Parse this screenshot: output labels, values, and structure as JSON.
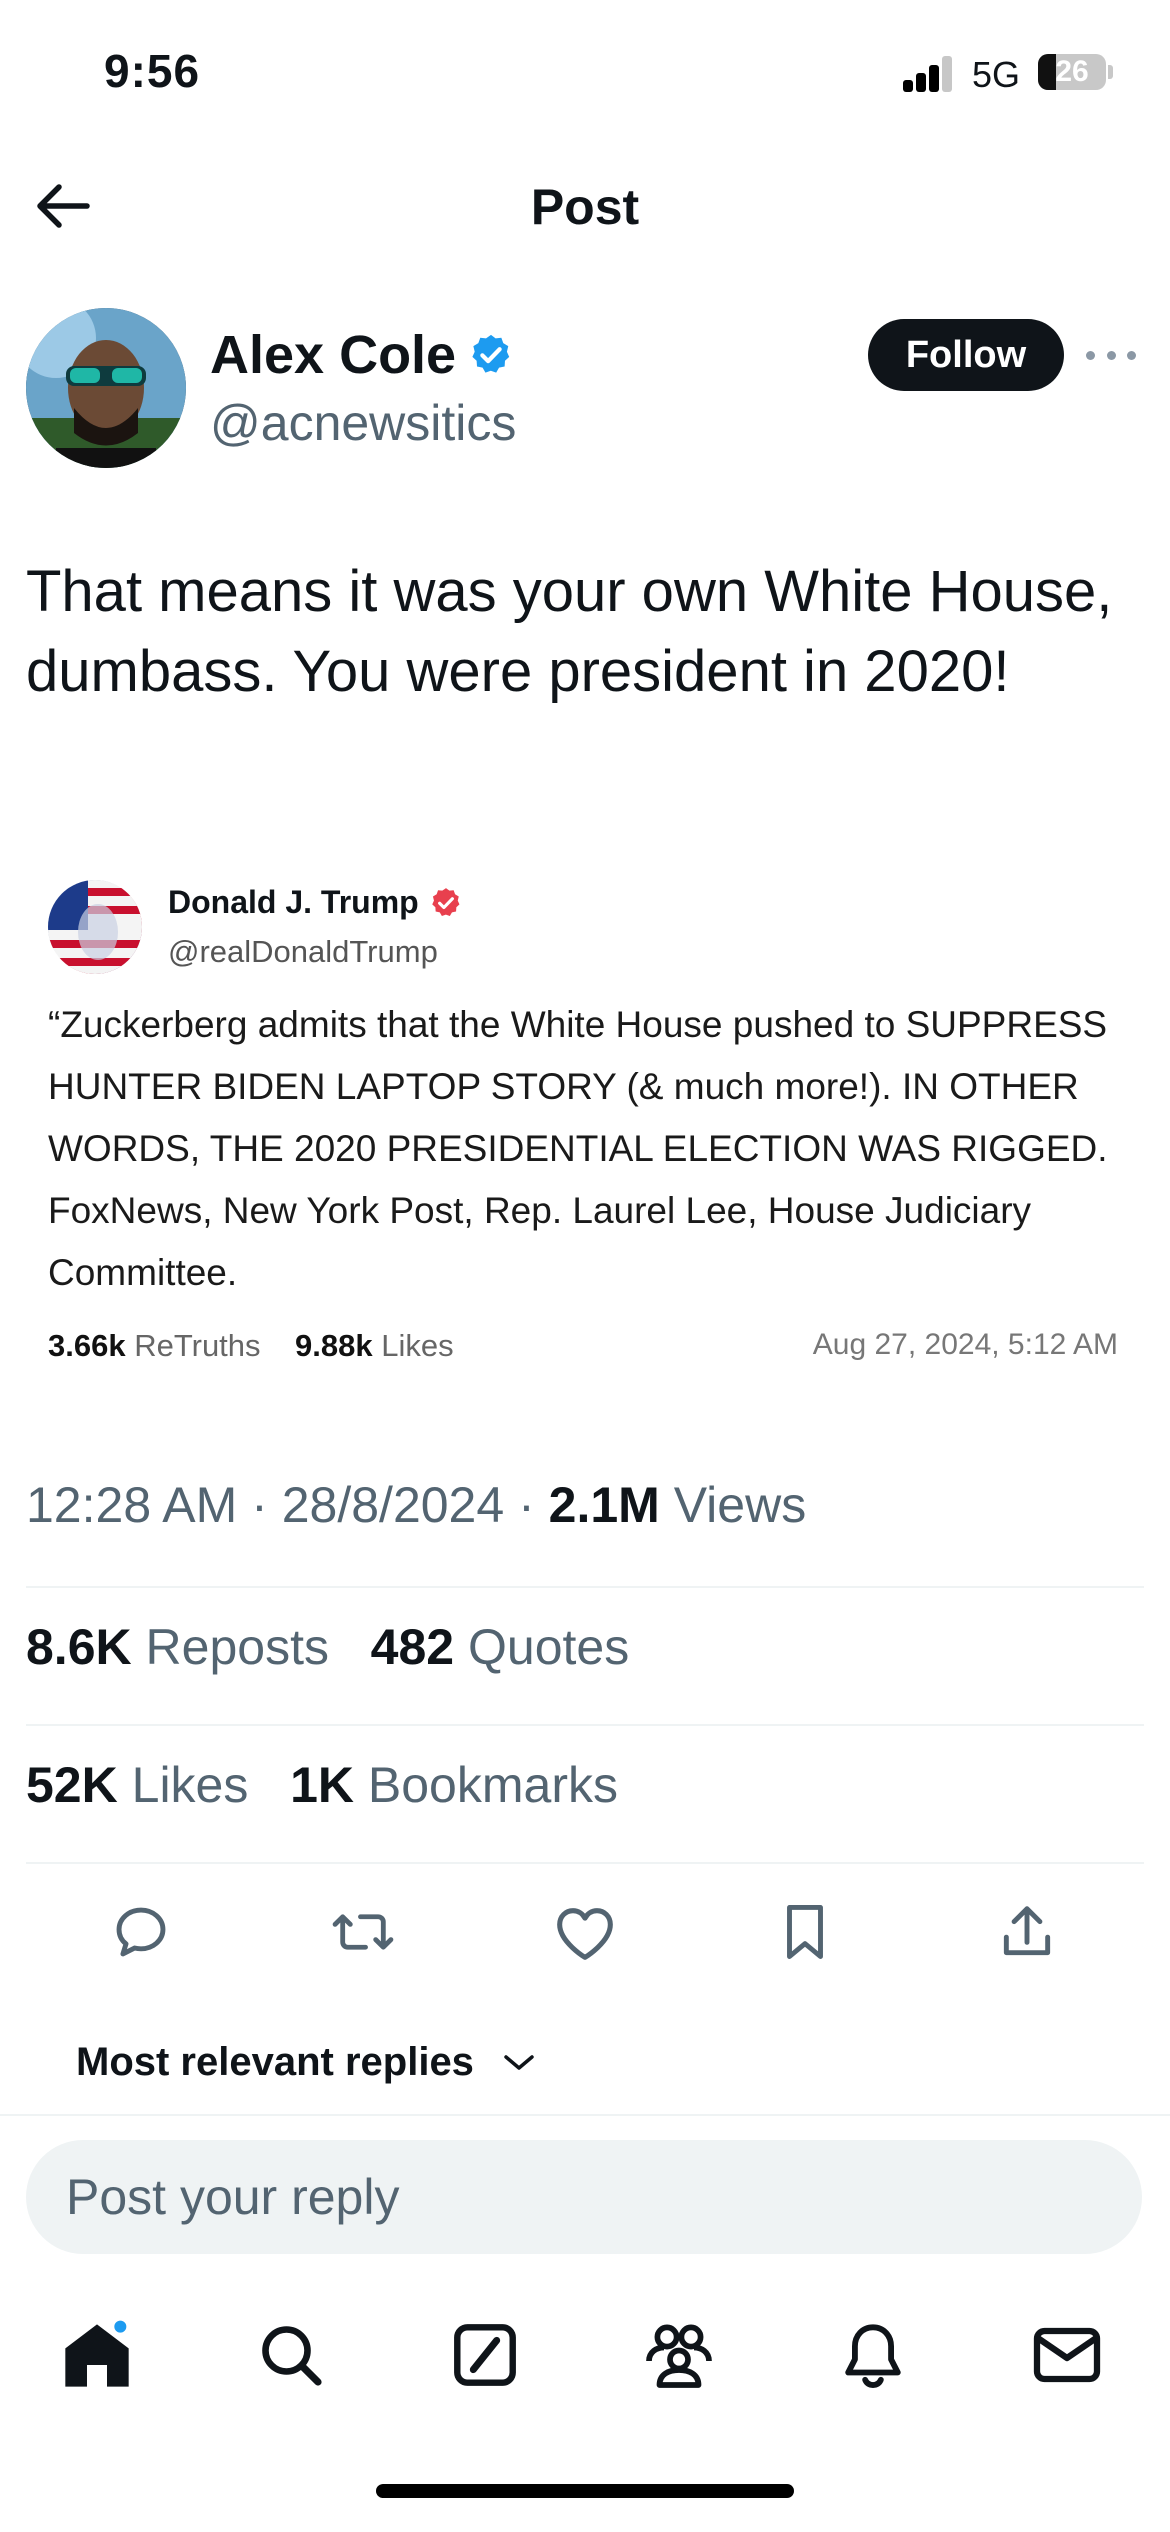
{
  "status": {
    "time": "9:56",
    "network": "5G",
    "battery": "26"
  },
  "header": {
    "title": "Post"
  },
  "author": {
    "name": "Alex Cole",
    "handle": "@acnewsitics",
    "follow_label": "Follow"
  },
  "tweet": {
    "text": "That means it was your own White House, dumbass. You were president in 2020!"
  },
  "quoted": {
    "name": "Donald J. Trump",
    "handle": "@realDonaldTrump",
    "text": "“Zuckerberg admits that the White House pushed to SUPPRESS HUNTER BIDEN LAPTOP STORY (& much more!). IN OTHER WORDS, THE 2020 PRESIDENTIAL ELECTION WAS RIGGED. FoxNews, New York Post, Rep. Laurel Lee, House Judiciary Committee.",
    "retruths_count": "3.66k",
    "retruths_label": "ReTruths",
    "likes_count": "9.88k",
    "likes_label": "Likes",
    "date": "Aug 27, 2024, 5:12 AM"
  },
  "meta": {
    "time": "12:28 AM",
    "date": "28/8/2024",
    "views_count": "2.1M",
    "views_label": "Views"
  },
  "stats": {
    "reposts_count": "8.6K",
    "reposts_label": "Reposts",
    "quotes_count": "482",
    "quotes_label": "Quotes",
    "likes_count": "52K",
    "likes_label": "Likes",
    "bookmarks_count": "1K",
    "bookmarks_label": "Bookmarks"
  },
  "replies": {
    "sort_label": "Most relevant replies"
  },
  "reply_input": {
    "placeholder": "Post your reply"
  },
  "colors": {
    "verified_blue": "#1d9bf0",
    "truth_verified": "#e8404e",
    "notification_dot": "#1d9bf0"
  },
  "tabs": [
    "home-icon",
    "search-icon",
    "grok-icon",
    "communities-icon",
    "notifications-icon",
    "messages-icon"
  ]
}
